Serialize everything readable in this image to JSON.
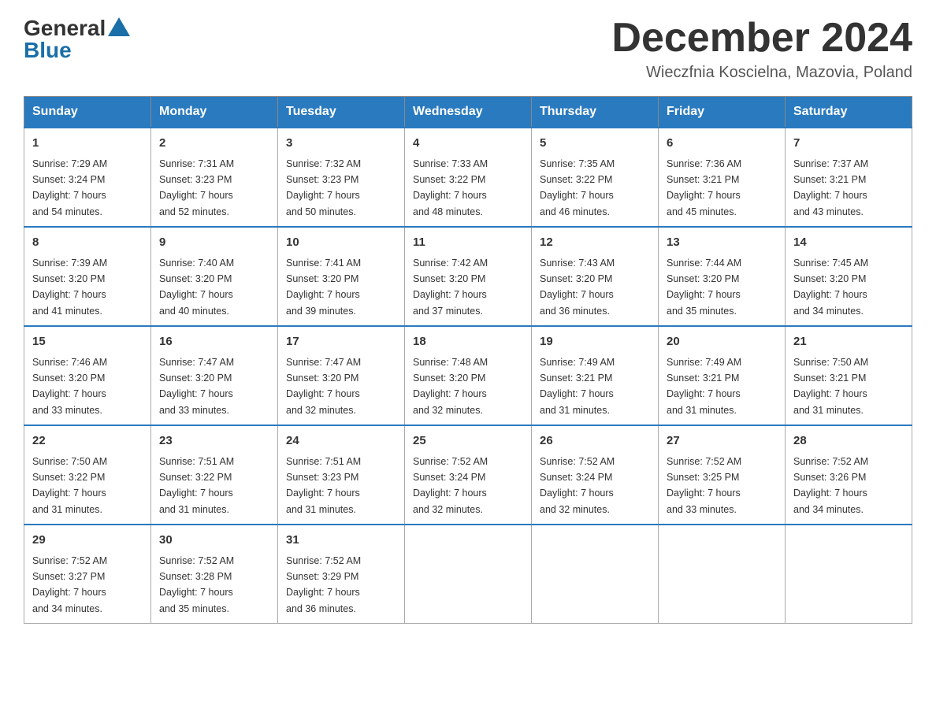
{
  "header": {
    "logo_general": "General",
    "logo_blue": "Blue",
    "month_title": "December 2024",
    "subtitle": "Wieczfnia Koscielna, Mazovia, Poland"
  },
  "days_of_week": [
    "Sunday",
    "Monday",
    "Tuesday",
    "Wednesday",
    "Thursday",
    "Friday",
    "Saturday"
  ],
  "weeks": [
    [
      {
        "day": "1",
        "sunrise": "7:29 AM",
        "sunset": "3:24 PM",
        "daylight": "7 hours and 54 minutes."
      },
      {
        "day": "2",
        "sunrise": "7:31 AM",
        "sunset": "3:23 PM",
        "daylight": "7 hours and 52 minutes."
      },
      {
        "day": "3",
        "sunrise": "7:32 AM",
        "sunset": "3:23 PM",
        "daylight": "7 hours and 50 minutes."
      },
      {
        "day": "4",
        "sunrise": "7:33 AM",
        "sunset": "3:22 PM",
        "daylight": "7 hours and 48 minutes."
      },
      {
        "day": "5",
        "sunrise": "7:35 AM",
        "sunset": "3:22 PM",
        "daylight": "7 hours and 46 minutes."
      },
      {
        "day": "6",
        "sunrise": "7:36 AM",
        "sunset": "3:21 PM",
        "daylight": "7 hours and 45 minutes."
      },
      {
        "day": "7",
        "sunrise": "7:37 AM",
        "sunset": "3:21 PM",
        "daylight": "7 hours and 43 minutes."
      }
    ],
    [
      {
        "day": "8",
        "sunrise": "7:39 AM",
        "sunset": "3:20 PM",
        "daylight": "7 hours and 41 minutes."
      },
      {
        "day": "9",
        "sunrise": "7:40 AM",
        "sunset": "3:20 PM",
        "daylight": "7 hours and 40 minutes."
      },
      {
        "day": "10",
        "sunrise": "7:41 AM",
        "sunset": "3:20 PM",
        "daylight": "7 hours and 39 minutes."
      },
      {
        "day": "11",
        "sunrise": "7:42 AM",
        "sunset": "3:20 PM",
        "daylight": "7 hours and 37 minutes."
      },
      {
        "day": "12",
        "sunrise": "7:43 AM",
        "sunset": "3:20 PM",
        "daylight": "7 hours and 36 minutes."
      },
      {
        "day": "13",
        "sunrise": "7:44 AM",
        "sunset": "3:20 PM",
        "daylight": "7 hours and 35 minutes."
      },
      {
        "day": "14",
        "sunrise": "7:45 AM",
        "sunset": "3:20 PM",
        "daylight": "7 hours and 34 minutes."
      }
    ],
    [
      {
        "day": "15",
        "sunrise": "7:46 AM",
        "sunset": "3:20 PM",
        "daylight": "7 hours and 33 minutes."
      },
      {
        "day": "16",
        "sunrise": "7:47 AM",
        "sunset": "3:20 PM",
        "daylight": "7 hours and 33 minutes."
      },
      {
        "day": "17",
        "sunrise": "7:47 AM",
        "sunset": "3:20 PM",
        "daylight": "7 hours and 32 minutes."
      },
      {
        "day": "18",
        "sunrise": "7:48 AM",
        "sunset": "3:20 PM",
        "daylight": "7 hours and 32 minutes."
      },
      {
        "day": "19",
        "sunrise": "7:49 AM",
        "sunset": "3:21 PM",
        "daylight": "7 hours and 31 minutes."
      },
      {
        "day": "20",
        "sunrise": "7:49 AM",
        "sunset": "3:21 PM",
        "daylight": "7 hours and 31 minutes."
      },
      {
        "day": "21",
        "sunrise": "7:50 AM",
        "sunset": "3:21 PM",
        "daylight": "7 hours and 31 minutes."
      }
    ],
    [
      {
        "day": "22",
        "sunrise": "7:50 AM",
        "sunset": "3:22 PM",
        "daylight": "7 hours and 31 minutes."
      },
      {
        "day": "23",
        "sunrise": "7:51 AM",
        "sunset": "3:22 PM",
        "daylight": "7 hours and 31 minutes."
      },
      {
        "day": "24",
        "sunrise": "7:51 AM",
        "sunset": "3:23 PM",
        "daylight": "7 hours and 31 minutes."
      },
      {
        "day": "25",
        "sunrise": "7:52 AM",
        "sunset": "3:24 PM",
        "daylight": "7 hours and 32 minutes."
      },
      {
        "day": "26",
        "sunrise": "7:52 AM",
        "sunset": "3:24 PM",
        "daylight": "7 hours and 32 minutes."
      },
      {
        "day": "27",
        "sunrise": "7:52 AM",
        "sunset": "3:25 PM",
        "daylight": "7 hours and 33 minutes."
      },
      {
        "day": "28",
        "sunrise": "7:52 AM",
        "sunset": "3:26 PM",
        "daylight": "7 hours and 34 minutes."
      }
    ],
    [
      {
        "day": "29",
        "sunrise": "7:52 AM",
        "sunset": "3:27 PM",
        "daylight": "7 hours and 34 minutes."
      },
      {
        "day": "30",
        "sunrise": "7:52 AM",
        "sunset": "3:28 PM",
        "daylight": "7 hours and 35 minutes."
      },
      {
        "day": "31",
        "sunrise": "7:52 AM",
        "sunset": "3:29 PM",
        "daylight": "7 hours and 36 minutes."
      },
      null,
      null,
      null,
      null
    ]
  ],
  "labels": {
    "sunrise": "Sunrise:",
    "sunset": "Sunset:",
    "daylight": "Daylight:"
  }
}
